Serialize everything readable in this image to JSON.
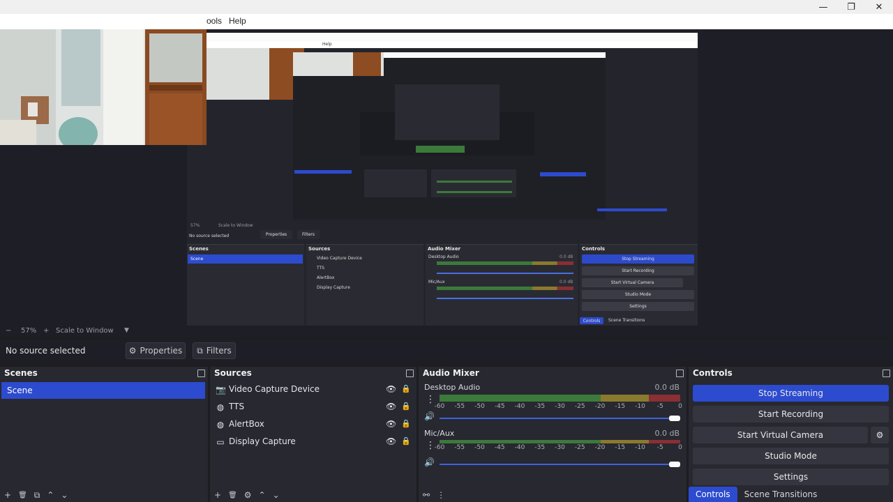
{
  "window": {
    "minimize_glyph": "—",
    "maximize_glyph": "❐",
    "close_glyph": "✕"
  },
  "menu": {
    "tools_label": "ools",
    "help_label": "Help"
  },
  "preview": {
    "nested": {
      "help_label": "Help",
      "zoom_label": "57%",
      "scale_label": "Scale to Window",
      "no_source": "No source selected",
      "properties": "Properties",
      "filters": "Filters",
      "scenes_title": "Scenes",
      "scene_item": "Scene",
      "sources_title": "Sources",
      "sources": [
        "Video Capture Device",
        "TTS",
        "AlertBox",
        "Display Capture"
      ],
      "mixer_title": "Audio Mixer",
      "desktop_audio": "Desktop Audio",
      "mic_aux": "Mic/Aux",
      "db": "0.0 dB",
      "controls_title": "Controls",
      "stop_streaming": "Stop Streaming",
      "start_recording": "Start Recording",
      "start_virtual_camera": "Start Virtual Camera",
      "studio_mode": "Studio Mode",
      "settings": "Settings",
      "tab_controls": "Controls",
      "tab_transitions": "Scene Transitions"
    }
  },
  "zoombar": {
    "minus": "−",
    "zoom": "57%",
    "plus": "+",
    "scale": "Scale to Window",
    "dropdown": "▼"
  },
  "source_toolbar": {
    "no_source": "No source selected",
    "properties": "Properties",
    "filters": "Filters"
  },
  "scenes": {
    "title": "Scenes",
    "items": [
      "Scene"
    ],
    "toolbar": {
      "add": "+",
      "remove": "🗑",
      "filter": "⧉",
      "up": "⌃",
      "down": "⌄"
    }
  },
  "sources": {
    "title": "Sources",
    "items": [
      {
        "name": "Video Capture Device",
        "icon": "camera-icon"
      },
      {
        "name": "TTS",
        "icon": "globe-icon"
      },
      {
        "name": "AlertBox",
        "icon": "globe-icon"
      },
      {
        "name": "Display Capture",
        "icon": "monitor-icon"
      }
    ],
    "toolbar": {
      "add": "+",
      "remove": "🗑",
      "settings": "⚙",
      "up": "⌃",
      "down": "⌄"
    }
  },
  "mixer": {
    "title": "Audio Mixer",
    "ticks": [
      "-60",
      "-55",
      "-50",
      "-45",
      "-40",
      "-35",
      "-30",
      "-25",
      "-20",
      "-15",
      "-10",
      "-5",
      "0"
    ],
    "channels": [
      {
        "name": "Desktop Audio",
        "db": "0.0 dB",
        "volume": 1.0
      },
      {
        "name": "Mic/Aux",
        "db": "0.0 dB",
        "volume": 1.0
      }
    ],
    "toolbar": {
      "link": "⚯",
      "menu": "⋮"
    }
  },
  "controls": {
    "title": "Controls",
    "stop_streaming": "Stop Streaming",
    "start_recording": "Start Recording",
    "start_virtual_camera": "Start Virtual Camera",
    "studio_mode": "Studio Mode",
    "settings": "Settings",
    "tabs": [
      "Controls",
      "Scene Transitions"
    ]
  },
  "colors": {
    "accent": "#2d4bcf",
    "meter_green": "#3b7a3a",
    "meter_yellow": "#8a7a2d",
    "meter_red": "#8a2f33"
  }
}
